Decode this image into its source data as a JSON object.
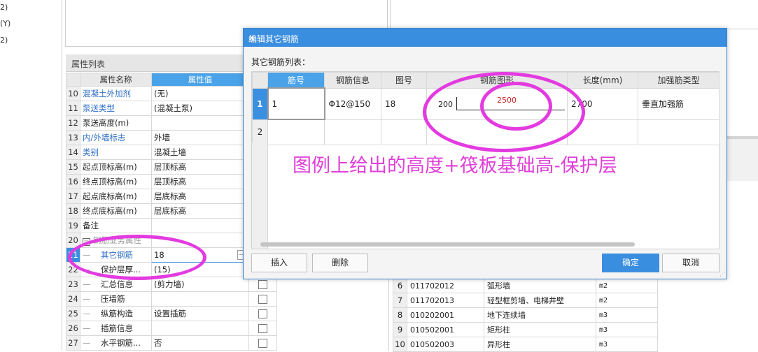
{
  "left_strip": [
    "2)",
    "(Y)",
    "2)"
  ],
  "property_panel": {
    "title": "属性列表",
    "col_name": "属性名称",
    "col_value": "属性值",
    "rows": [
      {
        "n": "10",
        "name": "混凝土外加剂",
        "value": "(无)",
        "blue": true,
        "chk": false,
        "group": false,
        "indent": false
      },
      {
        "n": "11",
        "name": "泵送类型",
        "value": "(混凝土泵)",
        "blue": true,
        "chk": false,
        "group": false,
        "indent": false
      },
      {
        "n": "12",
        "name": "泵送高度(m)",
        "value": "",
        "blue": false,
        "chk": false,
        "group": false,
        "indent": false
      },
      {
        "n": "13",
        "name": "内/外墙标志",
        "value": "外墙",
        "blue": true,
        "chk": false,
        "group": false,
        "indent": false
      },
      {
        "n": "14",
        "name": "类别",
        "value": "混凝土墙",
        "blue": true,
        "chk": false,
        "group": false,
        "indent": false
      },
      {
        "n": "15",
        "name": "起点顶标高(m)",
        "value": "层顶标高",
        "blue": false,
        "chk": false,
        "group": false,
        "indent": false
      },
      {
        "n": "16",
        "name": "终点顶标高(m)",
        "value": "层顶标高",
        "blue": false,
        "chk": false,
        "group": false,
        "indent": false
      },
      {
        "n": "17",
        "name": "起点底标高(m)",
        "value": "层底标高",
        "blue": false,
        "chk": false,
        "group": false,
        "indent": false
      },
      {
        "n": "18",
        "name": "终点底标高(m)",
        "value": "层底标高",
        "blue": false,
        "chk": false,
        "group": false,
        "indent": false
      },
      {
        "n": "19",
        "name": "备注",
        "value": "",
        "blue": false,
        "chk": false,
        "group": false,
        "indent": false
      },
      {
        "n": "20",
        "name": "钢筋业务属性",
        "value": "",
        "blue": false,
        "chk": false,
        "group": true,
        "indent": false
      },
      {
        "n": "21",
        "name": "其它钢筋",
        "value": "18",
        "blue": true,
        "chk": false,
        "group": false,
        "indent": true,
        "selected": true
      },
      {
        "n": "22",
        "name": "保护层厚...",
        "value": "(15)",
        "blue": false,
        "chk": true,
        "group": false,
        "indent": true
      },
      {
        "n": "23",
        "name": "汇总信息",
        "value": "(剪力墙)",
        "blue": false,
        "chk": true,
        "group": false,
        "indent": true
      },
      {
        "n": "24",
        "name": "压墙筋",
        "value": "",
        "blue": false,
        "chk": true,
        "group": false,
        "indent": true
      },
      {
        "n": "25",
        "name": "纵筋构造",
        "value": "设置插筋",
        "blue": false,
        "chk": true,
        "group": false,
        "indent": true
      },
      {
        "n": "26",
        "name": "插筋信息",
        "value": "",
        "blue": false,
        "chk": true,
        "group": false,
        "indent": true
      },
      {
        "n": "27",
        "name": "水平钢筋...",
        "value": "否",
        "blue": false,
        "chk": true,
        "group": false,
        "indent": true
      }
    ]
  },
  "code_list": [
    {
      "n": "6",
      "code": "011702012",
      "name": "弧形墙",
      "unit": "m2"
    },
    {
      "n": "7",
      "code": "011702013",
      "name": "轻型框剪墙、电梯井壁",
      "unit": "m2"
    },
    {
      "n": "8",
      "code": "010202001",
      "name": "地下连续墙",
      "unit": "m3"
    },
    {
      "n": "9",
      "code": "010502001",
      "name": "矩形柱",
      "unit": "m3"
    },
    {
      "n": "10",
      "code": "010502003",
      "name": "异形柱",
      "unit": "m3"
    }
  ],
  "dialog": {
    "title": "编辑其它钢筋",
    "close": "×",
    "list_label": "其它钢筋列表：",
    "columns": [
      "筋号",
      "钢筋信息",
      "图号",
      "钢筋图形",
      "长度(mm)",
      "加强筋类型"
    ],
    "rows": [
      {
        "n": "1",
        "bar_no": "1",
        "info": "Φ12@150",
        "fig": "18",
        "shape_left": "200",
        "shape_mid": "2500",
        "length": "2700",
        "type": "垂直加强筋"
      },
      {
        "n": "2",
        "bar_no": "",
        "info": "",
        "fig": "",
        "shape_left": "",
        "shape_mid": "",
        "length": "",
        "type": ""
      }
    ],
    "buttons": {
      "insert": "插入",
      "delete": "删除",
      "ok": "确定",
      "cancel": "取消"
    },
    "colors": {
      "accent": "#3a8ee0",
      "shape_label": "#cc2222"
    }
  },
  "annotation": {
    "text": "图例上给出的高度+筏板基础高-保护层",
    "color": "#e040d8"
  }
}
